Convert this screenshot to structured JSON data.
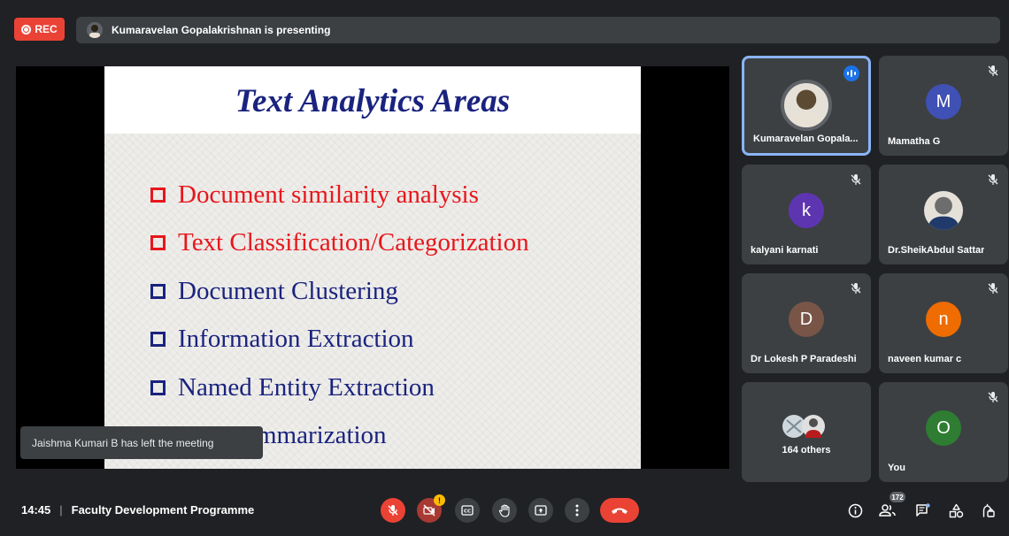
{
  "topbar": {
    "rec_label": "REC",
    "presenting_text": "Kumaravelan Gopalakrishnan is presenting"
  },
  "slide": {
    "title": "Text Analytics Areas",
    "bullets": [
      {
        "text": "Document similarity analysis",
        "color": "#e8161b"
      },
      {
        "text": "Text Classification/Categorization",
        "color": "#e8161b"
      },
      {
        "text": "Document Clustering",
        "color": "#1a237e"
      },
      {
        "text": "Information Extraction",
        "color": "#1a237e"
      },
      {
        "text": "Named Entity Extraction",
        "color": "#1a237e"
      },
      {
        "text": "Text Summarization",
        "color": "#1a237e"
      }
    ]
  },
  "toast": {
    "text": "Jaishma Kumari B has left the meeting"
  },
  "participants": [
    {
      "name": "Kumaravelan Gopala...",
      "initial": "",
      "avatar": "photo",
      "color": "#5d4a33",
      "active": true,
      "muted": false
    },
    {
      "name": "Mamatha G",
      "initial": "M",
      "avatar": "letter",
      "color": "#3f51b5",
      "active": false,
      "muted": true
    },
    {
      "name": "kalyani karnati",
      "initial": "k",
      "avatar": "letter",
      "color": "#5e35b1",
      "active": false,
      "muted": true
    },
    {
      "name": "Dr.SheikAbdul Sattar",
      "initial": "",
      "avatar": "photo",
      "color": "#6d6d6d",
      "active": false,
      "muted": true
    },
    {
      "name": "Dr Lokesh P Paradeshi",
      "initial": "D",
      "avatar": "letter",
      "color": "#795548",
      "active": false,
      "muted": true
    },
    {
      "name": "naveen kumar c",
      "initial": "n",
      "avatar": "letter",
      "color": "#ef6c00",
      "active": false,
      "muted": true
    },
    {
      "name": "164 others",
      "initial": "",
      "avatar": "group",
      "color": "#5f6368",
      "active": false,
      "muted": false
    },
    {
      "name": "You",
      "initial": "O",
      "avatar": "letter",
      "color": "#2e7d32",
      "active": false,
      "muted": true
    }
  ],
  "bottombar": {
    "time": "14:45",
    "separator": "|",
    "meeting_title": "Faculty Development Programme",
    "people_count": "172"
  },
  "colors": {
    "accent": "#8ab4f8",
    "danger": "#ea4335",
    "surface": "#3c4043",
    "background": "#202124"
  },
  "icons": [
    "mic-off-icon",
    "camera-off-icon",
    "captions-icon",
    "raise-hand-icon",
    "present-icon",
    "more-options-icon",
    "end-call-icon",
    "info-icon",
    "people-icon",
    "chat-icon",
    "activities-icon",
    "host-controls-icon"
  ]
}
